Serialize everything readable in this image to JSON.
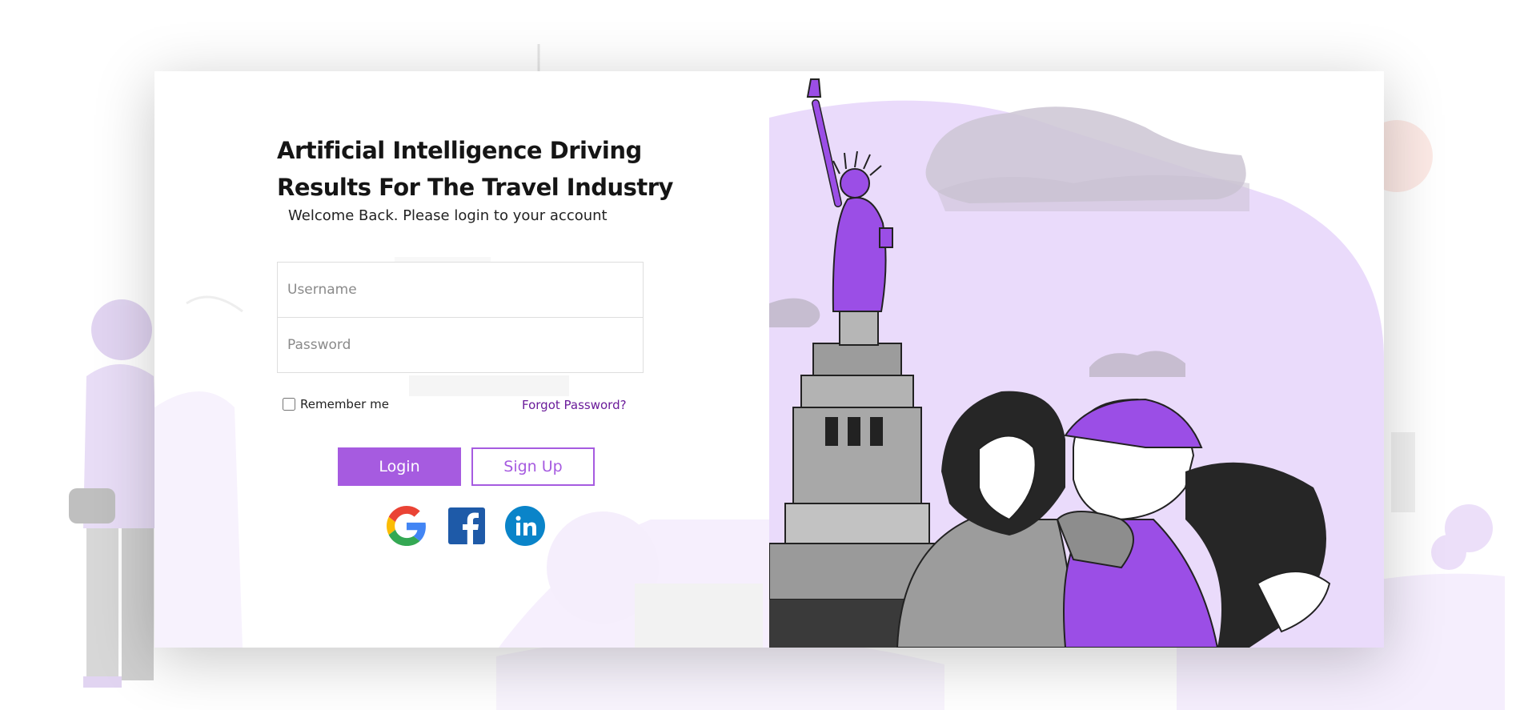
{
  "login": {
    "headline_line1": "Artificial Intelligence Driving",
    "headline_line2": "Results For The Travel Industry",
    "subtitle": "Welcome Back. Please login to your account",
    "username_placeholder": "Username",
    "password_placeholder": "Password",
    "remember_label": "Remember me",
    "forgot_label": "Forgot Password?",
    "login_label": "Login",
    "signup_label": "Sign Up"
  },
  "social": [
    {
      "name": "google",
      "icon": "google-icon"
    },
    {
      "name": "facebook",
      "icon": "facebook-icon"
    },
    {
      "name": "linkedin",
      "icon": "linkedin-icon"
    }
  ],
  "illustration": {
    "subject": "statue-of-liberty-and-travelers",
    "icons": [
      "statue-of-liberty-icon",
      "traveler-couple-icon",
      "cloud-icon"
    ]
  },
  "colors": {
    "accent": "#a65be0",
    "link": "#6a1b9a",
    "blob": "#eadbfb",
    "statue": "#9b4ee6",
    "text": "#151515"
  }
}
